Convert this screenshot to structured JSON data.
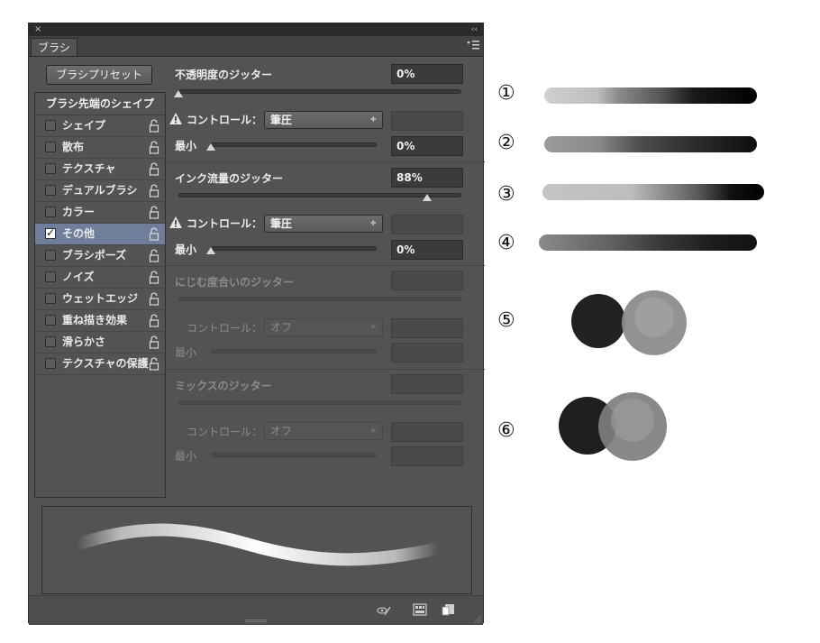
{
  "panel": {
    "close_glyph": "×",
    "collapse_glyph": "‹‹",
    "tab_title": "ブラシ",
    "menu_icon": "panel-menu-icon",
    "preset_button": "ブラシプリセット"
  },
  "sidebar": {
    "header": "ブラシ先端のシェイプ",
    "items": [
      {
        "label": "シェイプ",
        "checked": false
      },
      {
        "label": "散布",
        "checked": false
      },
      {
        "label": "テクスチャ",
        "checked": false
      },
      {
        "label": "デュアルブラシ",
        "checked": false
      },
      {
        "label": "カラー",
        "checked": false
      },
      {
        "label": "その他",
        "checked": true,
        "selected": true
      },
      {
        "label": "ブラシポーズ",
        "checked": false
      },
      {
        "label": "ノイズ",
        "checked": false
      },
      {
        "label": "ウェットエッジ",
        "checked": false
      },
      {
        "label": "重ね描き効果",
        "checked": false
      },
      {
        "label": "滑らかさ",
        "checked": false
      },
      {
        "label": "テクスチャの保護",
        "checked": false
      }
    ],
    "check_glyph": "✓"
  },
  "settings": {
    "opacity_jitter": {
      "label": "不透明度のジッター",
      "value": "0%",
      "slider": 0.0
    },
    "opacity_control": {
      "label": "コントロール：",
      "value": "筆圧"
    },
    "opacity_min": {
      "label": "最小",
      "value": "0%",
      "slider": 0.0
    },
    "flow_jitter": {
      "label": "インク流量のジッター",
      "value": "88%",
      "slider": 0.88
    },
    "flow_control": {
      "label": "コントロール：",
      "value": "筆圧"
    },
    "flow_min": {
      "label": "最小",
      "value": "0%",
      "slider": 0.0
    },
    "wet_jitter": {
      "label": "にじむ度合いのジッター"
    },
    "wet_control": {
      "label": "コントロール：",
      "value": "オフ"
    },
    "wet_min": {
      "label": "最小"
    },
    "mix_jitter": {
      "label": "ミックスのジッター"
    },
    "mix_control": {
      "label": "コントロール：",
      "value": "オフ"
    },
    "mix_min": {
      "label": "最小"
    },
    "select_arrow": "÷"
  },
  "examples": {
    "labels": [
      "①",
      "②",
      "③",
      "④",
      "⑤",
      "⑥"
    ]
  },
  "colors": {
    "panel_bg": "#535353",
    "selected_row": "#6f7f9b"
  }
}
